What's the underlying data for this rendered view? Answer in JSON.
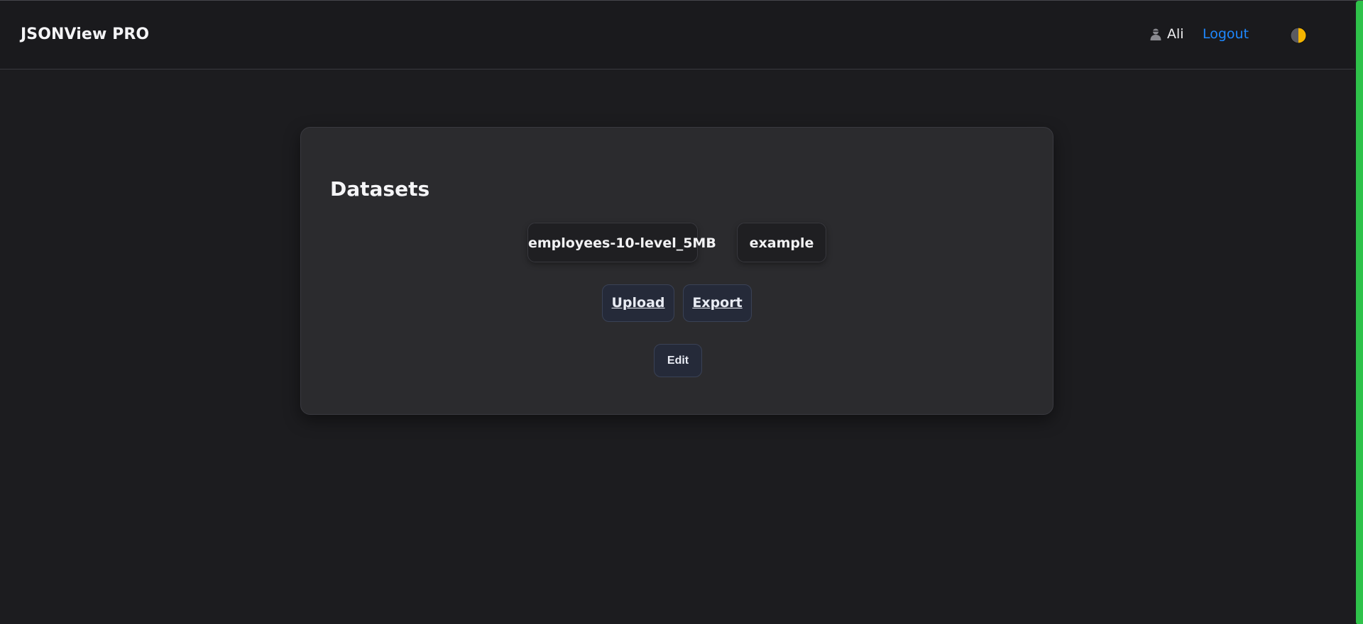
{
  "header": {
    "brand": "JSONView PRO",
    "user_name": "Ali",
    "logout_label": "Logout",
    "user_icon": "user-icon",
    "theme_icon": "half-moon-theme-icon"
  },
  "datasets_card": {
    "title": "Datasets",
    "datasets": [
      {
        "label": "employees-10-level_5MB"
      },
      {
        "label": "example"
      }
    ],
    "actions": {
      "upload_label": "Upload",
      "export_label": "Export",
      "edit_label": "Edit"
    }
  },
  "colors": {
    "background": "#1c1c1f",
    "card": "#2b2b2e",
    "link_accent": "#1e88ff",
    "scroll_indicator": "#2fc24a"
  }
}
